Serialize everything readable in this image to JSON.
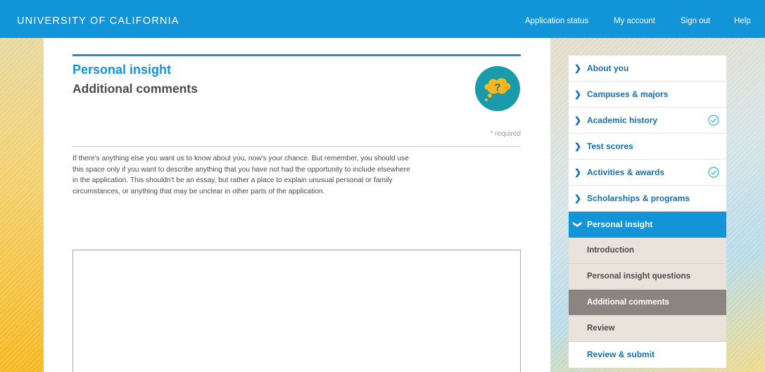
{
  "header": {
    "brand": "UNIVERSITY OF CALIFORNIA",
    "nav": [
      {
        "label": "Application status"
      },
      {
        "label": "My account"
      },
      {
        "label": "Sign out"
      },
      {
        "label": "Help"
      }
    ]
  },
  "main": {
    "section_title": "Personal insight",
    "page_title": "Additional comments",
    "help_icon": "question-thought-bubble-icon",
    "required_note": "* required",
    "instructions": "If there's anything else you want us to know about you, now's your chance. But remember, you should use this space only if you want to describe anything that you have not had the opportunity to include elsewhere in the application. This shouldn't be an essay, but rather a place to explain unusual personal or family circumstances, or anything that may be unclear in other parts of the application.",
    "comments_value": ""
  },
  "sidebar": {
    "items": [
      {
        "label": "About you",
        "completed": false
      },
      {
        "label": "Campuses & majors",
        "completed": false
      },
      {
        "label": "Academic history",
        "completed": true
      },
      {
        "label": "Test scores",
        "completed": false
      },
      {
        "label": "Activities & awards",
        "completed": true
      },
      {
        "label": "Scholarships & programs",
        "completed": false
      },
      {
        "label": "Personal insight",
        "expanded": true
      }
    ],
    "subitems": [
      {
        "label": "Introduction"
      },
      {
        "label": "Personal insight questions"
      },
      {
        "label": "Additional comments",
        "current": true
      },
      {
        "label": "Review"
      }
    ],
    "submit_label": "Review & submit"
  },
  "colors": {
    "accent": "#1295d8",
    "current_subitem": "#8c8480",
    "subitem_bg": "#e9e3dc",
    "help_icon_bg": "#1a9bab",
    "help_icon_fg": "#f6b820"
  }
}
